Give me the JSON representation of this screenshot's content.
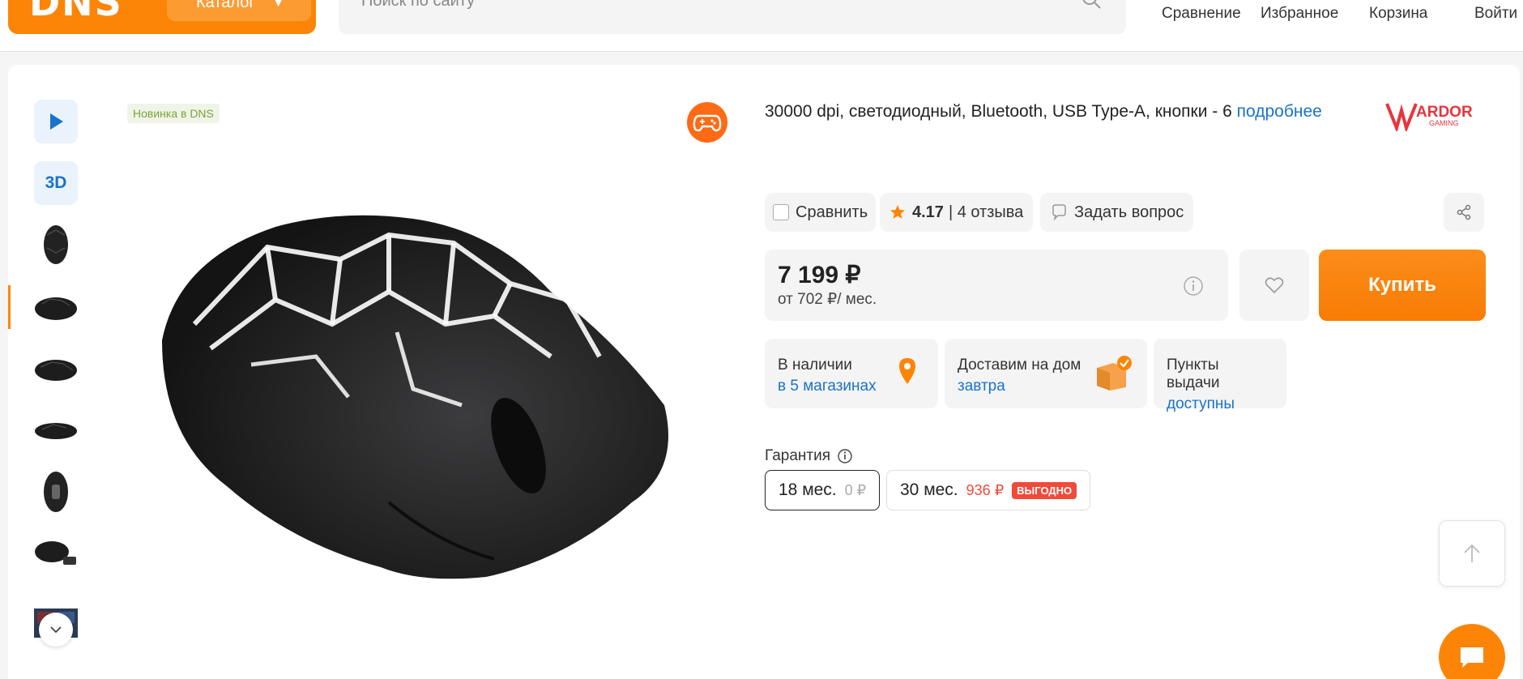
{
  "header": {
    "logo": "DNS",
    "catalog_label": "Каталог",
    "search_placeholder": "Поиск по сайту",
    "nav": [
      "Сравнение",
      "Избранное",
      "Корзина",
      "Войти"
    ]
  },
  "gallery": {
    "badge": "Новинка в DNS",
    "three_d_label": "3D",
    "thumbnails": [
      "play-icon",
      "3d-view",
      "mouse-top",
      "mouse-angle-active",
      "mouse-side",
      "mouse-flat",
      "mouse-bottom",
      "mouse-with-dongle",
      "mouse-box"
    ],
    "active_index": 3
  },
  "product": {
    "specs": "30000 dpi, светодиодный, Bluetooth, USB Type-A, кнопки - 6",
    "more_link": "подробнее",
    "brand": "ARDOR",
    "brand_sub": "GAMING"
  },
  "actions": {
    "compare": "Сравнить",
    "rating": "4.17",
    "reviews": "| 4 отзыва",
    "ask": "Задать вопрос"
  },
  "price": {
    "value": "7 199 ₽",
    "credit": "от 702 ₽/ мес.",
    "buy_label": "Купить"
  },
  "availability": [
    {
      "title": "В наличии",
      "link": "в 5 магазинах"
    },
    {
      "title": "Доставим на дом",
      "link": "завтра"
    },
    {
      "title": "Пункты выдачи",
      "link": "доступны"
    }
  ],
  "warranty": {
    "label": "Гарантия",
    "options": [
      {
        "term": "18 мес.",
        "price": "0 ₽",
        "selected": true
      },
      {
        "term": "30 мес.",
        "price": "936 ₽",
        "badge": "ВЫГОДНО",
        "selected": false
      }
    ]
  },
  "colors": {
    "accent": "#fc8507",
    "link": "#1a73c9",
    "badge_red": "#f04a3a"
  }
}
